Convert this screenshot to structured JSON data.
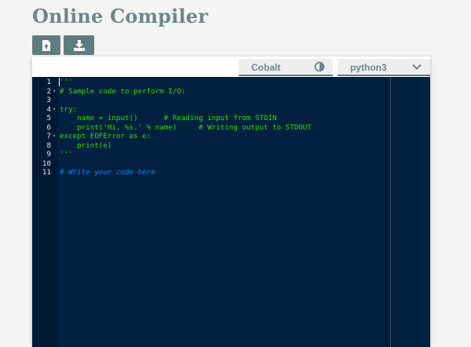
{
  "page": {
    "title": "Online Compiler"
  },
  "toolbar": {
    "upload_icon": "file-upload-icon",
    "download_icon": "download-icon"
  },
  "editor_header": {
    "theme_label": "Cobalt",
    "theme_icon": "contrast-icon",
    "language_label": "python3",
    "language_icon": "chevron-down-icon"
  },
  "colors": {
    "accent": "#5f7d81",
    "editor_bg": "#002240",
    "code_text": "#3ad900",
    "comment": "#0088ff"
  },
  "code_lines": [
    {
      "num": "1",
      "fold": "",
      "text": "'''",
      "type": "code"
    },
    {
      "num": "2",
      "fold": "▾",
      "text": "# Sample code to perform I/O:",
      "type": "code"
    },
    {
      "num": "3",
      "fold": "",
      "text": "",
      "type": "code"
    },
    {
      "num": "4",
      "fold": "▾",
      "text": "try:",
      "type": "code"
    },
    {
      "num": "5",
      "fold": "",
      "text": "    name = input()      # Reading input from STDIN",
      "type": "code"
    },
    {
      "num": "6",
      "fold": "",
      "text": "    print('Hi, %s.' % name)     # Writing output to STDOUT",
      "type": "code"
    },
    {
      "num": "7",
      "fold": "▾",
      "text": "except EOFError as e:",
      "type": "code"
    },
    {
      "num": "8",
      "fold": "",
      "text": "    print(e)",
      "type": "code"
    },
    {
      "num": "9",
      "fold": "",
      "text": "'''",
      "type": "code"
    },
    {
      "num": "10",
      "fold": "",
      "text": "",
      "type": "code"
    },
    {
      "num": "11",
      "fold": "",
      "text": "# Write your code here",
      "type": "comment"
    }
  ]
}
